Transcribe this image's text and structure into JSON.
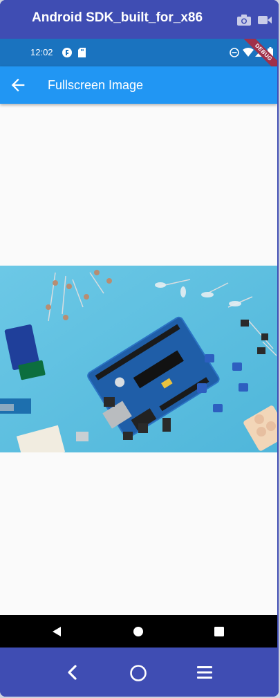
{
  "emulator": {
    "title": "Android SDK_built_for_x86",
    "toolbar_icons": [
      "camera-icon",
      "video-camera-icon"
    ],
    "bottom_nav_icons": [
      "back-chevron-icon",
      "home-circle-icon",
      "menu-icon"
    ]
  },
  "status_bar": {
    "time": "12:02",
    "left_icons": [
      "flutter-notification-icon",
      "sd-card-icon"
    ],
    "right_icons": [
      "do-not-disturb-icon",
      "wifi-icon",
      "signal-icon",
      "battery-icon"
    ],
    "debug_banner": "DEBUG"
  },
  "app_bar": {
    "title": "Fullscreen Image",
    "back_icon": "arrow-back-icon"
  },
  "content": {
    "image_subject": "arduino-board-electronics-photo"
  },
  "system_nav": {
    "buttons": [
      "back-triangle-icon",
      "home-dot-icon",
      "recents-square-icon"
    ]
  },
  "colors": {
    "emulator_frame": "#3f4db3",
    "status_bar": "#1a73bf",
    "app_bar": "#2196f3",
    "background": "#fafafa",
    "photo_background": "#5bbfe0"
  }
}
